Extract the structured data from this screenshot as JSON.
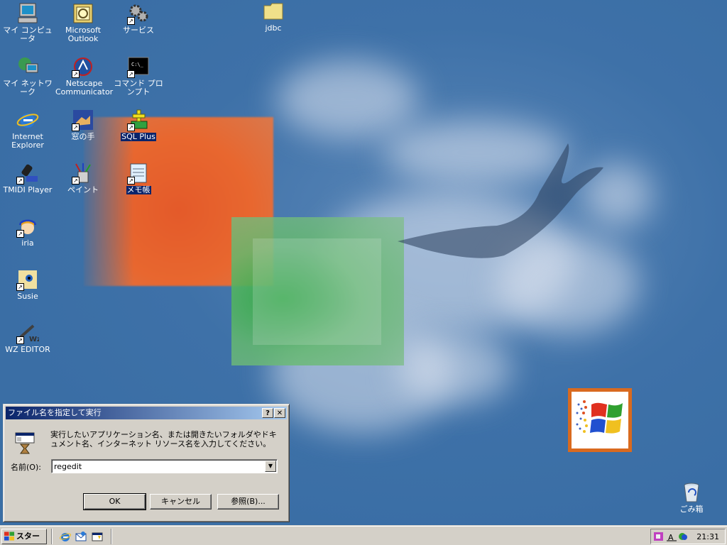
{
  "desktop": {
    "icons": [
      {
        "label": "マイ コンピュータ",
        "icon": "my-computer-icon"
      },
      {
        "label": "Microsoft Outlook",
        "icon": "outlook-icon"
      },
      {
        "label": "サービス",
        "icon": "services-icon"
      },
      {
        "label": "jdbc",
        "icon": "folder-icon"
      },
      {
        "label": "マイ ネットワーク",
        "icon": "network-icon"
      },
      {
        "label": "Netscape Communicator",
        "icon": "netscape-icon"
      },
      {
        "label": "コマンド プロンプト",
        "icon": "command-prompt-icon"
      },
      {
        "label": "Internet Explorer",
        "icon": "internet-explorer-icon"
      },
      {
        "label": "窓の手",
        "icon": "madonote-icon"
      },
      {
        "label": "SQL Plus",
        "icon": "sql-plus-icon"
      },
      {
        "label": "TMIDI Player",
        "icon": "tmidi-icon"
      },
      {
        "label": "ペイント",
        "icon": "paint-icon"
      },
      {
        "label": "メモ帳",
        "icon": "notepad-icon"
      },
      {
        "label": "iria",
        "icon": "iria-icon"
      },
      {
        "label": "Susie",
        "icon": "susie-icon"
      },
      {
        "label": "WZ EDITOR",
        "icon": "wz-editor-icon"
      },
      {
        "label": "ごみ箱",
        "icon": "recycle-bin-icon"
      }
    ]
  },
  "dialog": {
    "title": "ファイル名を指定して実行",
    "help_label": "?",
    "close_label": "✕",
    "description": "実行したいアプリケーション名、または開きたいフォルダやドキュメント名、インターネット リソース名を入力してください。",
    "name_label": "名前(O):",
    "input_value": "regedit",
    "dropdown_glyph": "▼",
    "ok_label": "OK",
    "cancel_label": "キャンセル",
    "browse_label": "参照(B)..."
  },
  "taskbar": {
    "start_label": "スタート",
    "clock": "21:31",
    "quick_launch": [
      "internet-explorer-icon",
      "outlook-express-icon",
      "show-desktop-icon"
    ]
  }
}
